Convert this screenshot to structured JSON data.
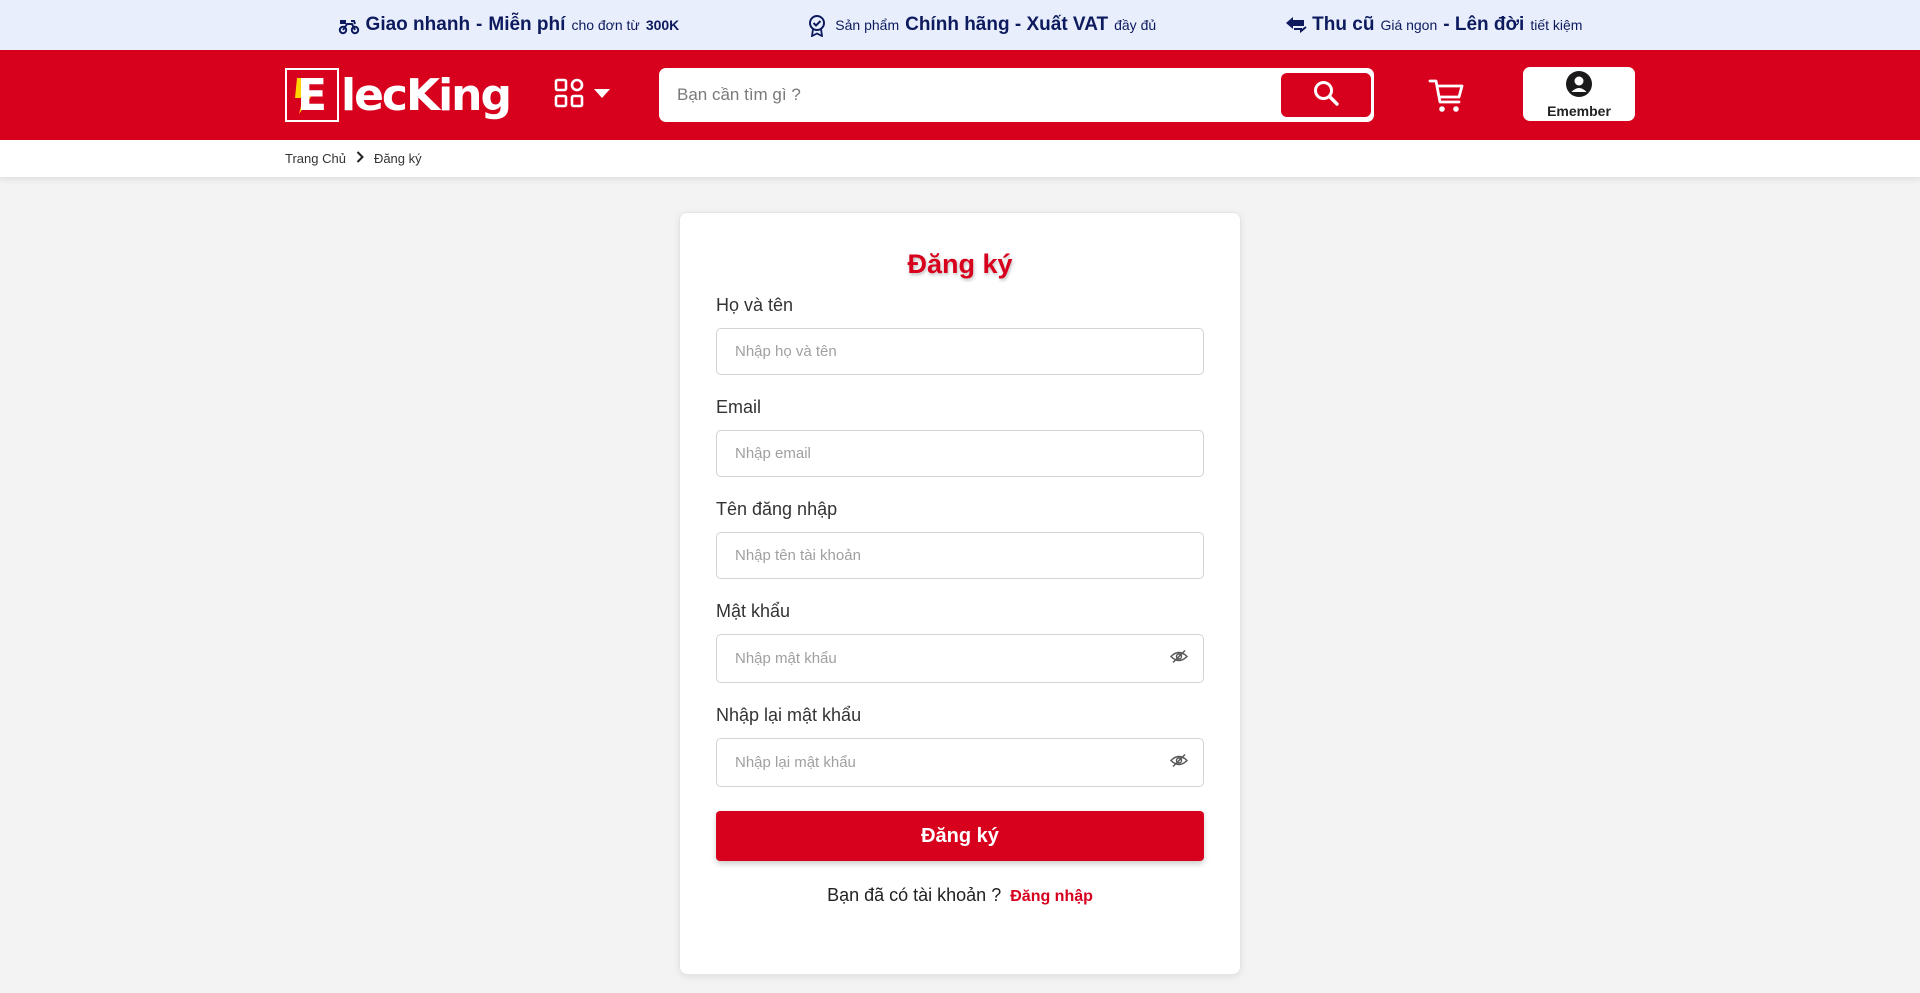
{
  "promo": {
    "item1": {
      "strong1": "Giao nhanh",
      "sep": "-",
      "strong2": "Miễn phí",
      "small": "cho đơn từ",
      "strong3": "300K"
    },
    "item2": {
      "small1": "Sản phẩm",
      "strong1": "Chính hãng - Xuất VAT",
      "small2": "đầy đủ"
    },
    "item3": {
      "strong1": "Thu cũ",
      "small1": "Giá ngon",
      "strong2": "- Lên đời",
      "small2": "tiết kiệm"
    }
  },
  "header": {
    "logo_letter": "E",
    "logo_text": "lecKing",
    "search_placeholder": "Bạn cần tìm gì ?",
    "member_label": "Emember"
  },
  "breadcrumb": {
    "home": "Trang Chủ",
    "current": "Đăng ký"
  },
  "form": {
    "title": "Đăng ký",
    "fields": [
      {
        "label": "Họ và tên",
        "placeholder": "Nhập họ và tên"
      },
      {
        "label": "Email",
        "placeholder": "Nhập email"
      },
      {
        "label": "Tên đăng nhập",
        "placeholder": "Nhập tên tài khoản"
      },
      {
        "label": "Mật khẩu",
        "placeholder": "Nhập mật khẩu"
      },
      {
        "label": "Nhập lại mật khẩu",
        "placeholder": "Nhập lại mật khẩu"
      }
    ],
    "submit_label": "Đăng ký",
    "login_prompt": "Bạn đã có tài khoản ?",
    "login_link": "Đăng nhập"
  },
  "colors": {
    "brand_red": "#d7001d",
    "promo_bg": "#e8eefb",
    "promo_text": "#0d1b5e"
  }
}
